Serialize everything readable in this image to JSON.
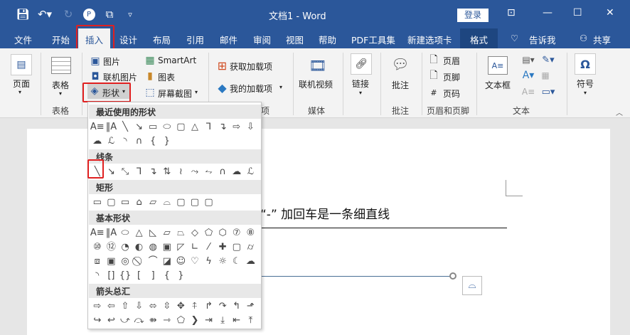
{
  "titlebar": {
    "title": "文档1  -  Word",
    "login": "登录"
  },
  "tabs": [
    "文件",
    "开始",
    "插入",
    "设计",
    "布局",
    "引用",
    "邮件",
    "审阅",
    "视图",
    "帮助",
    "PDF工具集",
    "新建选项卡",
    "格式"
  ],
  "tell_me": "告诉我",
  "share": "共享",
  "ribbon": {
    "pages": "页面",
    "table": "表格",
    "picture": "图片",
    "online_picture": "联机图片",
    "shapes": "形状",
    "smartart": "SmartArt",
    "chart": "图表",
    "screenshot": "屏幕截图",
    "get_addins": "获取加载项",
    "my_addins": "我的加载项",
    "online_video": "联机视频",
    "link": "链接",
    "comment": "批注",
    "header": "页眉",
    "footer": "页脚",
    "page_number": "页码",
    "textbox": "文本框",
    "symbol": "符号",
    "groups": {
      "table": "表格",
      "addins": "项",
      "media": "媒体",
      "comments": "批注",
      "header_footer": "页眉和页脚",
      "text": "文本"
    }
  },
  "document": {
    "text": "“-” 加回车是一条细直线"
  },
  "shapes_menu": {
    "sections": [
      {
        "title": "最近使用的形状",
        "rows": [
          [
            "textbox",
            "vertical-textbox",
            "line",
            "arrow",
            "rectangle",
            "oval",
            "rounded-rectangle",
            "triangle",
            "elbow-connector",
            "elbow-arrow",
            "right-arrow",
            "down-arrow"
          ],
          [
            "freeform",
            "scribble",
            "arc",
            "curve",
            "left-brace",
            "right-brace"
          ]
        ]
      },
      {
        "title": "线条",
        "rows": [
          [
            "line",
            "arrow",
            "double-arrow",
            "elbow-connector",
            "elbow-arrow",
            "elbow-double-arrow",
            "curved-connector",
            "curved-arrow",
            "curved-double-arrow",
            "curve",
            "freeform",
            "scribble"
          ]
        ]
      },
      {
        "title": "矩形",
        "rows": [
          [
            "rectangle",
            "rounded-rectangle",
            "snip-corner",
            "snip-same-side",
            "snip-diagonal",
            "round-snip",
            "round-corner",
            "round-same-side",
            "round-diagonal"
          ]
        ]
      },
      {
        "title": "基本形状",
        "rows": [
          [
            "textbox",
            "vertical-textbox",
            "oval",
            "triangle",
            "right-triangle",
            "parallelogram",
            "trapezoid",
            "diamond",
            "pentagon",
            "hexagon",
            "heptagon",
            "octagon"
          ],
          [
            "decagon",
            "dodecagon",
            "pie",
            "chord",
            "teardrop",
            "frame",
            "half-frame",
            "l-shape",
            "diagonal-stripe",
            "cross",
            "plaque",
            "can"
          ],
          [
            "cube",
            "bevel",
            "donut",
            "no-symbol",
            "block-arc",
            "folded-corner",
            "smiley",
            "heart",
            "lightning",
            "sun",
            "moon",
            "cloud"
          ],
          [
            "arc",
            "double-bracket",
            "double-brace",
            "left-bracket",
            "right-bracket",
            "left-brace",
            "right-brace"
          ]
        ]
      },
      {
        "title": "箭头总汇",
        "rows": [
          [
            "right-arrow",
            "left-arrow",
            "up-arrow",
            "down-arrow",
            "left-right-arrow",
            "up-down-arrow",
            "quad-arrow",
            "left-right-up-arrow",
            "bent-arrow",
            "u-turn-arrow",
            "left-up-arrow",
            "bent-up-arrow"
          ],
          [
            "curved-right-arrow",
            "curved-left-arrow",
            "curved-up-arrow",
            "curved-down-arrow",
            "striped-right-arrow",
            "notched-right-arrow",
            "pentagon-arrow",
            "chevron",
            "right-arrow-callout",
            "down-arrow-callout",
            "left-arrow-callout",
            "up-arrow-callout"
          ]
        ]
      }
    ]
  }
}
